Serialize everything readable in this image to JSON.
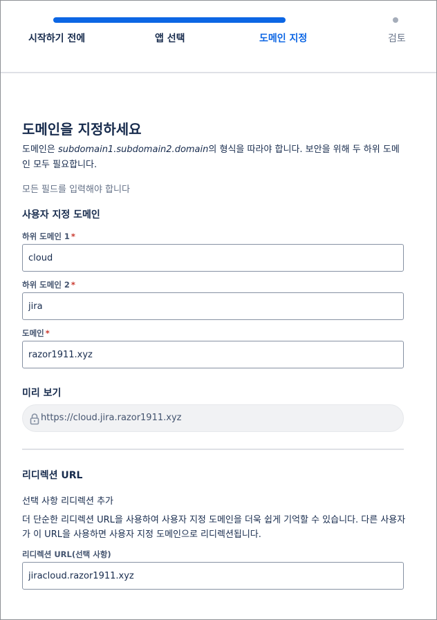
{
  "stepper": {
    "steps": [
      {
        "label": "시작하기 전에"
      },
      {
        "label": "앱 선택"
      },
      {
        "label": "도메인 지정"
      },
      {
        "label": "검토"
      }
    ],
    "active_index": 2,
    "active_color": "#0c66e4"
  },
  "main": {
    "heading": "도메인을 지정하세요",
    "desc_prefix": "도메인은 ",
    "desc_pattern": "subdomain1.subdomain2.domain",
    "desc_suffix": "의 형식을 따라야 합니다. 보안을 위해 두 하위 도메인 모두 필요합니다.",
    "required_note": "모든 필드를 입력해야 합니다"
  },
  "custom_domain": {
    "title": "사용자 지정 도메인",
    "fields": [
      {
        "label": "하위 도메인 1",
        "required_mark": "*",
        "value": "cloud"
      },
      {
        "label": "하위 도메인 2",
        "required_mark": "*",
        "value": "jira"
      },
      {
        "label": "도메인",
        "required_mark": "*",
        "value": "razor1911.xyz"
      }
    ]
  },
  "preview": {
    "title": "미리 보기",
    "url": "https://cloud.jira.razor1911.xyz",
    "icon": "lock-icon"
  },
  "redirect": {
    "title": "리디렉션 URL",
    "subtitle": "선택 사항 리디렉션 추가",
    "description": "더 단순한 리디렉션 URL을 사용하여 사용자 지정 도메인을 더욱 쉽게 기억할 수 있습니다. 다른 사용자가 이 URL을 사용하면 사용자 지정 도메인으로 리디렉션됩니다.",
    "field_label": "리디렉션 URL(선택 사항)",
    "field_value": "jiracloud.razor1911.xyz"
  },
  "colors": {
    "accent": "#0c66e4",
    "required": "#c9372c",
    "text": "#172b4d",
    "subtle": "#626f86"
  }
}
